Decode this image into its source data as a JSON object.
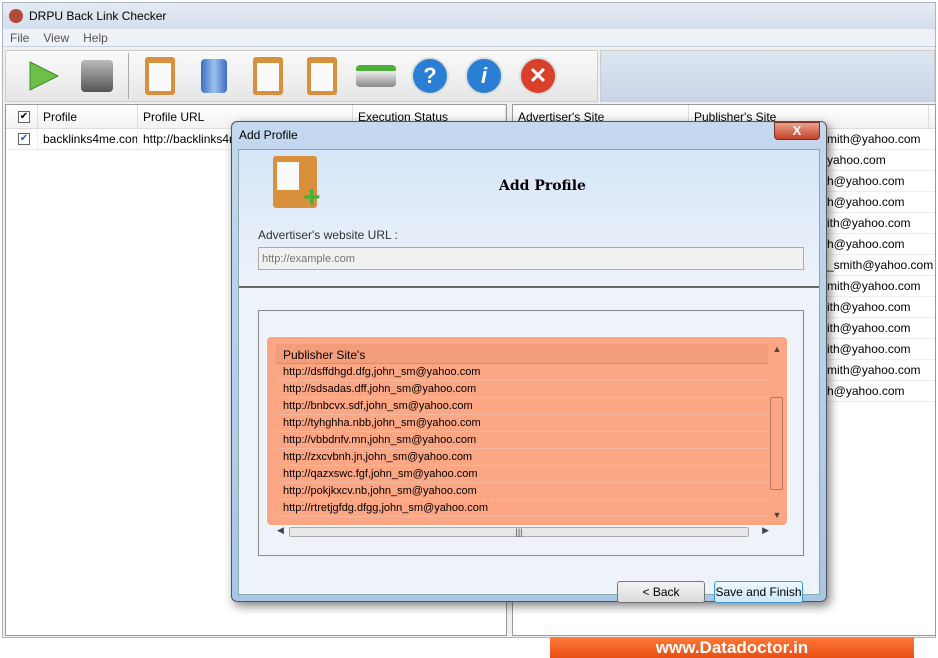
{
  "window": {
    "title": "DRPU Back Link Checker"
  },
  "menu": [
    "File",
    "View",
    "Help"
  ],
  "toolbar": {
    "icons": [
      "play-icon",
      "stop-icon",
      "add-profile-icon",
      "delete-icon",
      "edit-profile-icon",
      "settings-icon",
      "refresh-icon",
      "help-icon",
      "info-icon",
      "exit-icon"
    ]
  },
  "left_table": {
    "headers": [
      "Profile",
      "Profile URL",
      "Execution Status"
    ],
    "rows": [
      {
        "checked": true,
        "profile": "backlinks4me.com",
        "url": "http://backlinks4m"
      }
    ]
  },
  "right_table": {
    "headers": [
      "Advertiser's Site",
      "Publisher's Site"
    ],
    "rows": [
      "mith@yahoo.com",
      "yahoo.com",
      "h@yahoo.com",
      "h@yahoo.com",
      "ith@yahoo.com",
      "h@yahoo.com",
      "_smith@yahoo.com",
      "mith@yahoo.com",
      "ith@yahoo.com",
      "ith@yahoo.com",
      "ith@yahoo.com",
      "mith@yahoo.com",
      "h@yahoo.com"
    ]
  },
  "dialog": {
    "title": "Add Profile",
    "close": "X",
    "heading": "Add Profile",
    "url_label": "Advertiser's website URL :",
    "url_placeholder": "http://example.com",
    "list_header": "Publisher Site's",
    "list": [
      "http://dsffdhgd.dfg,john_sm@yahoo.com",
      "http://sdsadas.dff,john_sm@yahoo.com",
      "http://bnbcvx.sdf,john_sm@yahoo.com",
      "http://tyhghha.nbb,john_sm@yahoo.com",
      "http://vbbdnfv.mn,john_sm@yahoo.com",
      "http://zxcvbnh.jn,john_sm@yahoo.com",
      "http://qazxswc.fgf,john_sm@yahoo.com",
      "http://pokjkxcv.nb,john_sm@yahoo.com",
      "http://rtretjgfdg.dfgg,john_sm@yahoo.com"
    ],
    "back": "< Back",
    "save": "Save and Finish"
  },
  "banner": "www.Datadoctor.in",
  "colors": {
    "list_bg": "#fca684",
    "banner": "#f05a1a"
  }
}
